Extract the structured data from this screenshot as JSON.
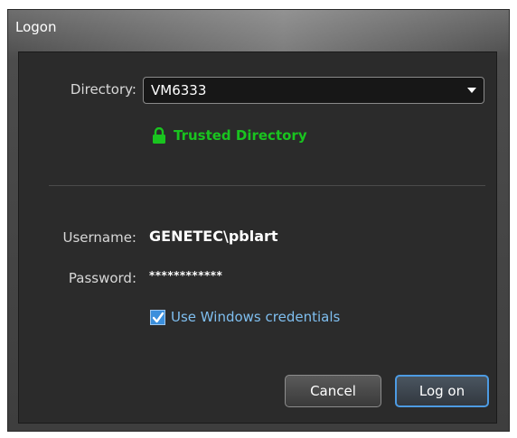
{
  "window": {
    "title": "Logon"
  },
  "form": {
    "directory_label": "Directory:",
    "directory_value": "VM6333",
    "trusted_text": "Trusted Directory",
    "username_label": "Username:",
    "username_value": "GENETEC\\pblart",
    "password_label": "Password:",
    "password_value": "************",
    "use_windows_credentials_label": "Use Windows credentials",
    "use_windows_credentials_checked": true
  },
  "buttons": {
    "cancel": "Cancel",
    "logon": "Log on"
  },
  "colors": {
    "trusted": "#19c41f",
    "accent": "#4d9be3",
    "checkbox_label": "#7fbff0"
  },
  "icons": {
    "trusted": "lock-icon",
    "directory_dropdown": "chevron-down-icon",
    "checkbox": "checkmark-icon"
  }
}
